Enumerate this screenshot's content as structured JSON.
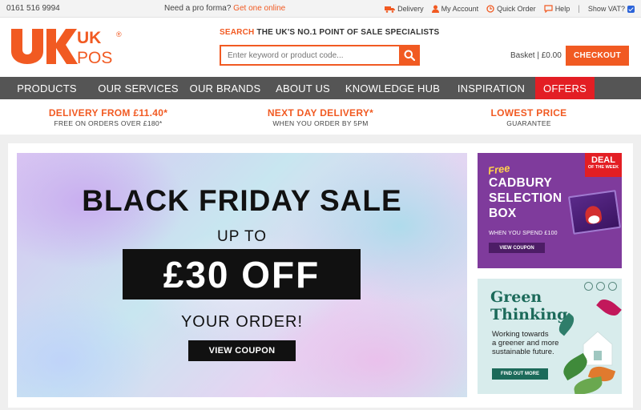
{
  "topbar": {
    "phone": "0161 516 9994",
    "proforma_text": "Need a pro forma?",
    "proforma_link": "Get one online",
    "links": [
      "Delivery",
      "My Account",
      "Quick Order",
      "Help"
    ],
    "show_vat_label": "Show VAT?",
    "show_vat_checked": true
  },
  "brand": {
    "logo_uk": "UK",
    "logo_pos": "POS",
    "logo_registered": "®",
    "accent": "#f15a22"
  },
  "header": {
    "tagline_prefix": "SEARCH",
    "tagline": "THE UK'S NO.1 POINT OF SALE SPECIALISTS",
    "search_placeholder": "Enter keyword or product code...",
    "basket_label": "Basket | £0.00",
    "checkout_label": "CHECKOUT"
  },
  "nav": {
    "items": [
      "PRODUCTS",
      "OUR SERVICES",
      "OUR BRANDS",
      "ABOUT US",
      "KNOWLEDGE HUB",
      "INSPIRATION",
      "OFFERS"
    ],
    "offers_color": "#e31e24"
  },
  "usp": [
    {
      "title": "DELIVERY FROM £11.40*",
      "sub": "FREE ON ORDERS OVER £180*"
    },
    {
      "title": "NEXT DAY DELIVERY*",
      "sub": "WHEN YOU ORDER BY 5PM"
    },
    {
      "title": "LOWEST PRICE",
      "sub": "GUARANTEE"
    }
  ],
  "hero": {
    "headline": "BLACK FRIDAY SALE",
    "up_to": "UP TO",
    "amount": "£30 OFF",
    "your_order": "YOUR ORDER!",
    "button": "VIEW COUPON"
  },
  "promo_cadbury": {
    "deal_line1": "DEAL",
    "deal_line2": "OF THE WEEK",
    "free": "Free",
    "title_line1": "CADBURY",
    "title_line2": "SELECTION",
    "title_line3": "BOX",
    "sub": "WHEN YOU SPEND £100",
    "button": "VIEW COUPON",
    "bg_color": "#7f3b9c"
  },
  "promo_green": {
    "title_line1": "Green",
    "title_line2": "Thinking",
    "sub_line1": "Working towards",
    "sub_line2": "a greener and more",
    "sub_line3": "sustainable future.",
    "button": "FIND OUT MORE",
    "accent": "#1c6a5a"
  }
}
